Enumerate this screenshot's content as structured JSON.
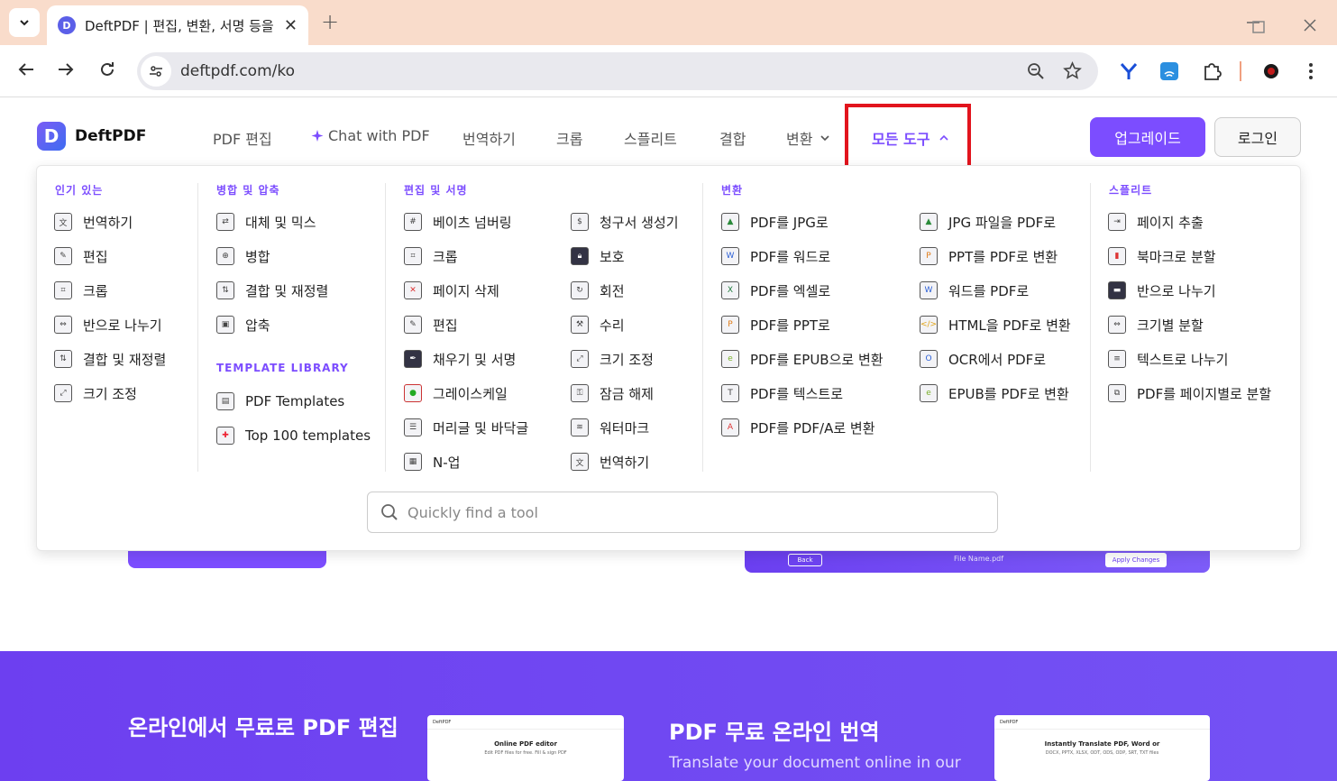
{
  "browser": {
    "tab_title": "DeftPDF | 편집, 변환, 서명 등을",
    "tab_favicon": "D",
    "tab_close": "✕",
    "new_tab": "+",
    "url": "deftpdf.com/ko",
    "controls": {
      "minimize": "—",
      "maximize": "☐",
      "close": "✕"
    }
  },
  "site": {
    "logo_letter": "D",
    "logo_text": "DeftPDF",
    "menu": {
      "edit": "PDF 편집",
      "chat": "Chat with PDF",
      "translate": "번역하기",
      "crop": "크롭",
      "split": "스플리트",
      "merge": "결합",
      "convert": "변환",
      "all_tools": "모든 도구"
    },
    "upgrade": "업그레이드",
    "login": "로그인",
    "accent": "#7c4dff",
    "highlight": "#e2141d"
  },
  "dropdown": {
    "popular": {
      "title": "인기 있는",
      "items": [
        "번역하기",
        "편집",
        "크롭",
        "반으로 나누기",
        "결합 및 재정렬",
        "크기 조정"
      ]
    },
    "merge": {
      "title": "병합 및 압축",
      "items": [
        "대체 및 믹스",
        "병합",
        "결합 및 재정렬",
        "압축"
      ]
    },
    "templates": {
      "title": "TEMPLATE LIBRARY",
      "items": [
        "PDF Templates",
        "Top 100 templates"
      ]
    },
    "edit": {
      "title": "편집 및 서명",
      "items_a": [
        "베이츠 넘버링",
        "크롭",
        "페이지 삭제",
        "편집",
        "채우기 및 서명",
        "그레이스케일",
        "머리글 및 바닥글",
        "N-업"
      ],
      "items_b": [
        "청구서 생성기",
        "보호",
        "회전",
        "수리",
        "크기 조정",
        "잠금 해제",
        "워터마크",
        "번역하기"
      ]
    },
    "convert": {
      "title": "변환",
      "items_a": [
        "PDF를 JPG로",
        "PDF를 워드로",
        "PDF를 엑셀로",
        "PDF를 PPT로",
        "PDF를 EPUB으로 변환",
        "PDF를 텍스트로",
        "PDF를 PDF/A로 변환"
      ],
      "items_b": [
        "JPG 파일을 PDF로",
        "PPT를 PDF로 변환",
        "워드를 PDF로",
        "HTML을 PDF로 변환",
        "OCR에서 PDF로",
        "EPUB를 PDF로 변환"
      ]
    },
    "split": {
      "title": "스플리트",
      "items": [
        "페이지 추출",
        "북마크로 분할",
        "반으로 나누기",
        "크기별 분할",
        "텍스트로 나누기",
        "PDF를 페이지별로 분할"
      ]
    },
    "search_placeholder": "Quickly find a tool"
  },
  "background": {
    "back": "Back",
    "file_name": "File Name.pdf",
    "apply": "Apply Changes",
    "heading1": "온라인에서 무료로 PDF 편집",
    "heading2": "PDF 무료 온라인 번역",
    "subtext": "Translate your document online in our",
    "thumb1_title": "Online PDF editor",
    "thumb1_sub": "Edit PDF files for free. Fill & sign PDF",
    "thumb2_title": "Instantly Translate PDF, Word or",
    "thumb2_sub": "DOCX, PPTX, XLSX, ODT, ODS, ODP, SRT, TXT files",
    "thumb_brand": "DeftPDF"
  }
}
